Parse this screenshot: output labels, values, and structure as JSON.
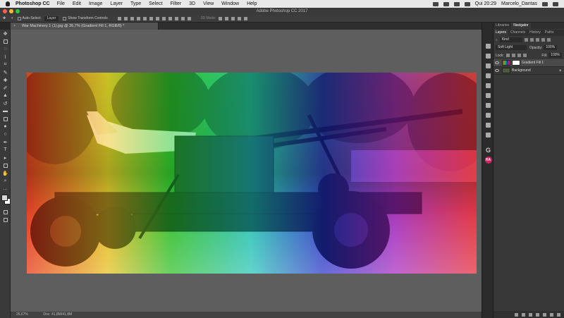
{
  "menubar": {
    "app_name": "Photoshop CC",
    "menus": [
      "File",
      "Edit",
      "Image",
      "Layer",
      "Type",
      "Select",
      "Filter",
      "3D",
      "View",
      "Window",
      "Help"
    ],
    "time": "Qui 20:29",
    "user": "Marcelo_Dantas"
  },
  "window": {
    "title": "Adobe Photoshop CC 2017"
  },
  "options_bar": {
    "auto_select_label": "Auto-Select:",
    "auto_select_value": "Layer",
    "transform_label": "Show Transform Controls",
    "mode_3d": "3D Mode:"
  },
  "document": {
    "tab_title": "War Machinery 1 (1).jpg @ 26,7% (Gradient Fill 1, RGB/8) *",
    "close_glyph": "×"
  },
  "status": {
    "zoom": "26,67%",
    "doc_info": "Doc: 41,8M/41,8M"
  },
  "right_strip": {
    "g_label": "G",
    "ra_label": "RA"
  },
  "panels": {
    "top_tabs": [
      "Libraries",
      "Navigator"
    ],
    "layer_tabs": [
      "Layers",
      "Channels",
      "History",
      "Paths"
    ],
    "kind_label": "Kind",
    "blend_mode": "Soft Light",
    "opacity_label": "Opacity:",
    "opacity_value": "100%",
    "lock_label": "Lock:",
    "fill_label": "Fill:",
    "fill_value": "100%",
    "layers": [
      {
        "name": "Gradient Fill 1"
      },
      {
        "name": "Background"
      }
    ]
  },
  "colors": {
    "gradient": [
      "#ff2a14",
      "#ffd020",
      "#22d12c",
      "#18d6d0",
      "#1c2ce0",
      "#b31fd8",
      "#ff1e3c"
    ],
    "foreground": "#d8d8d8",
    "background_swatch": "#ffffff"
  }
}
